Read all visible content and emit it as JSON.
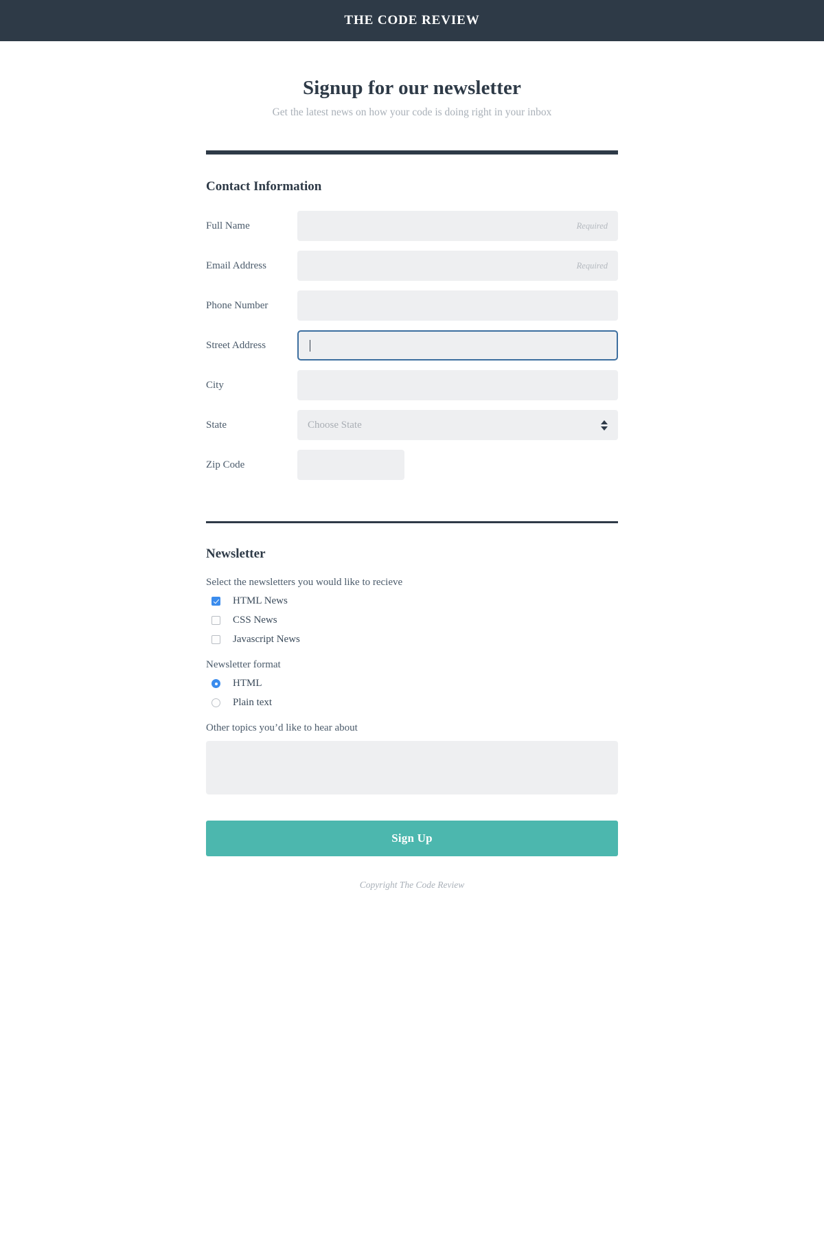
{
  "site": {
    "brand": "THE CODE REVIEW",
    "copyright": "Copyright The Code Review"
  },
  "hero": {
    "title": "Signup for our newsletter",
    "subtitle": "Get the latest news on how your code is doing right in your inbox"
  },
  "contact": {
    "heading": "Contact Information",
    "fields": [
      {
        "label": "Full Name",
        "type": "text",
        "value": "",
        "hint": "Required"
      },
      {
        "label": "Email Address",
        "type": "text",
        "value": "",
        "hint": "Required"
      },
      {
        "label": "Phone Number",
        "type": "text",
        "value": "",
        "hint": ""
      },
      {
        "label": "Street Address",
        "type": "text",
        "value": "",
        "hint": "",
        "focused": true
      },
      {
        "label": "City",
        "type": "text",
        "value": "",
        "hint": ""
      },
      {
        "label": "State",
        "type": "select",
        "value": "Choose State"
      },
      {
        "label": "Zip Code",
        "type": "text",
        "value": "",
        "hint": ""
      }
    ],
    "state_placeholder": "Choose State"
  },
  "newsletter": {
    "heading": "Newsletter",
    "checkbox_prompt": "Select the newsletters you would like to recieve",
    "checkboxes": [
      {
        "label": "HTML News",
        "checked": true
      },
      {
        "label": "CSS News",
        "checked": false
      },
      {
        "label": "Javascript News",
        "checked": false
      }
    ],
    "format_prompt": "Newsletter format",
    "radios": [
      {
        "label": "HTML",
        "selected": true
      },
      {
        "label": "Plain text",
        "selected": false
      }
    ],
    "other_prompt": "Other topics you’d like to hear about",
    "other_value": ""
  },
  "actions": {
    "submit_label": "Sign Up"
  },
  "colors": {
    "header_bg": "#2e3a47",
    "accent_button": "#4cb7ae",
    "focus_border": "#3c6e9f",
    "control_selected": "#3b8ced",
    "field_bg": "#eeeff1",
    "muted_text": "#a9b0b8"
  }
}
